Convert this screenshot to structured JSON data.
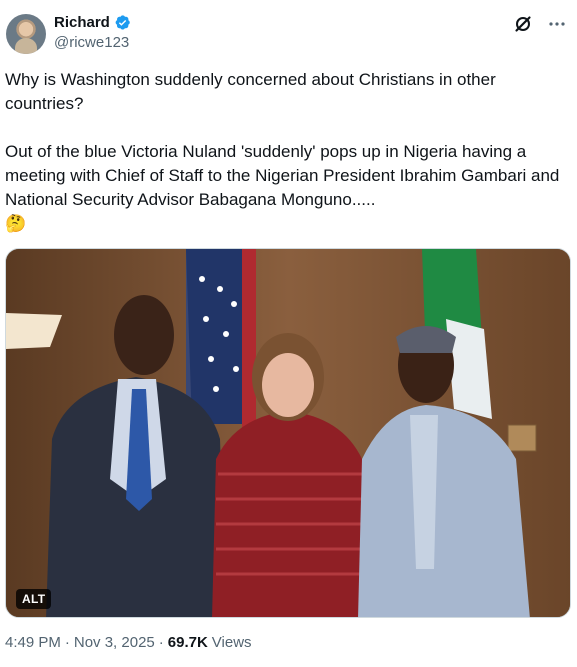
{
  "author": {
    "name": "Richard",
    "handle": "@ricwe123",
    "verified": true,
    "avatar_icon": "avatar-portrait"
  },
  "header_icons": [
    "grok-icon",
    "more-icon"
  ],
  "tweet": {
    "paragraph_1": "Why is Washington suddenly concerned about Christians in other countries?",
    "paragraph_2": "Out of the blue Victoria Nuland 'suddenly' pops up in Nigeria having a meeting with Chief of Staff to the Nigerian President Ibrahim Gambari and National Security Advisor Babagana Monguno.....",
    "emoji": "🤔"
  },
  "media": {
    "alt_badge": "ALT"
  },
  "meta": {
    "time": "4:49 PM",
    "date": "Nov 3, 2025",
    "views_count": "69.7K",
    "views_label": "Views"
  },
  "colors": {
    "text": "#0f1419",
    "secondary": "#536471",
    "verified": "#1d9bf0"
  }
}
